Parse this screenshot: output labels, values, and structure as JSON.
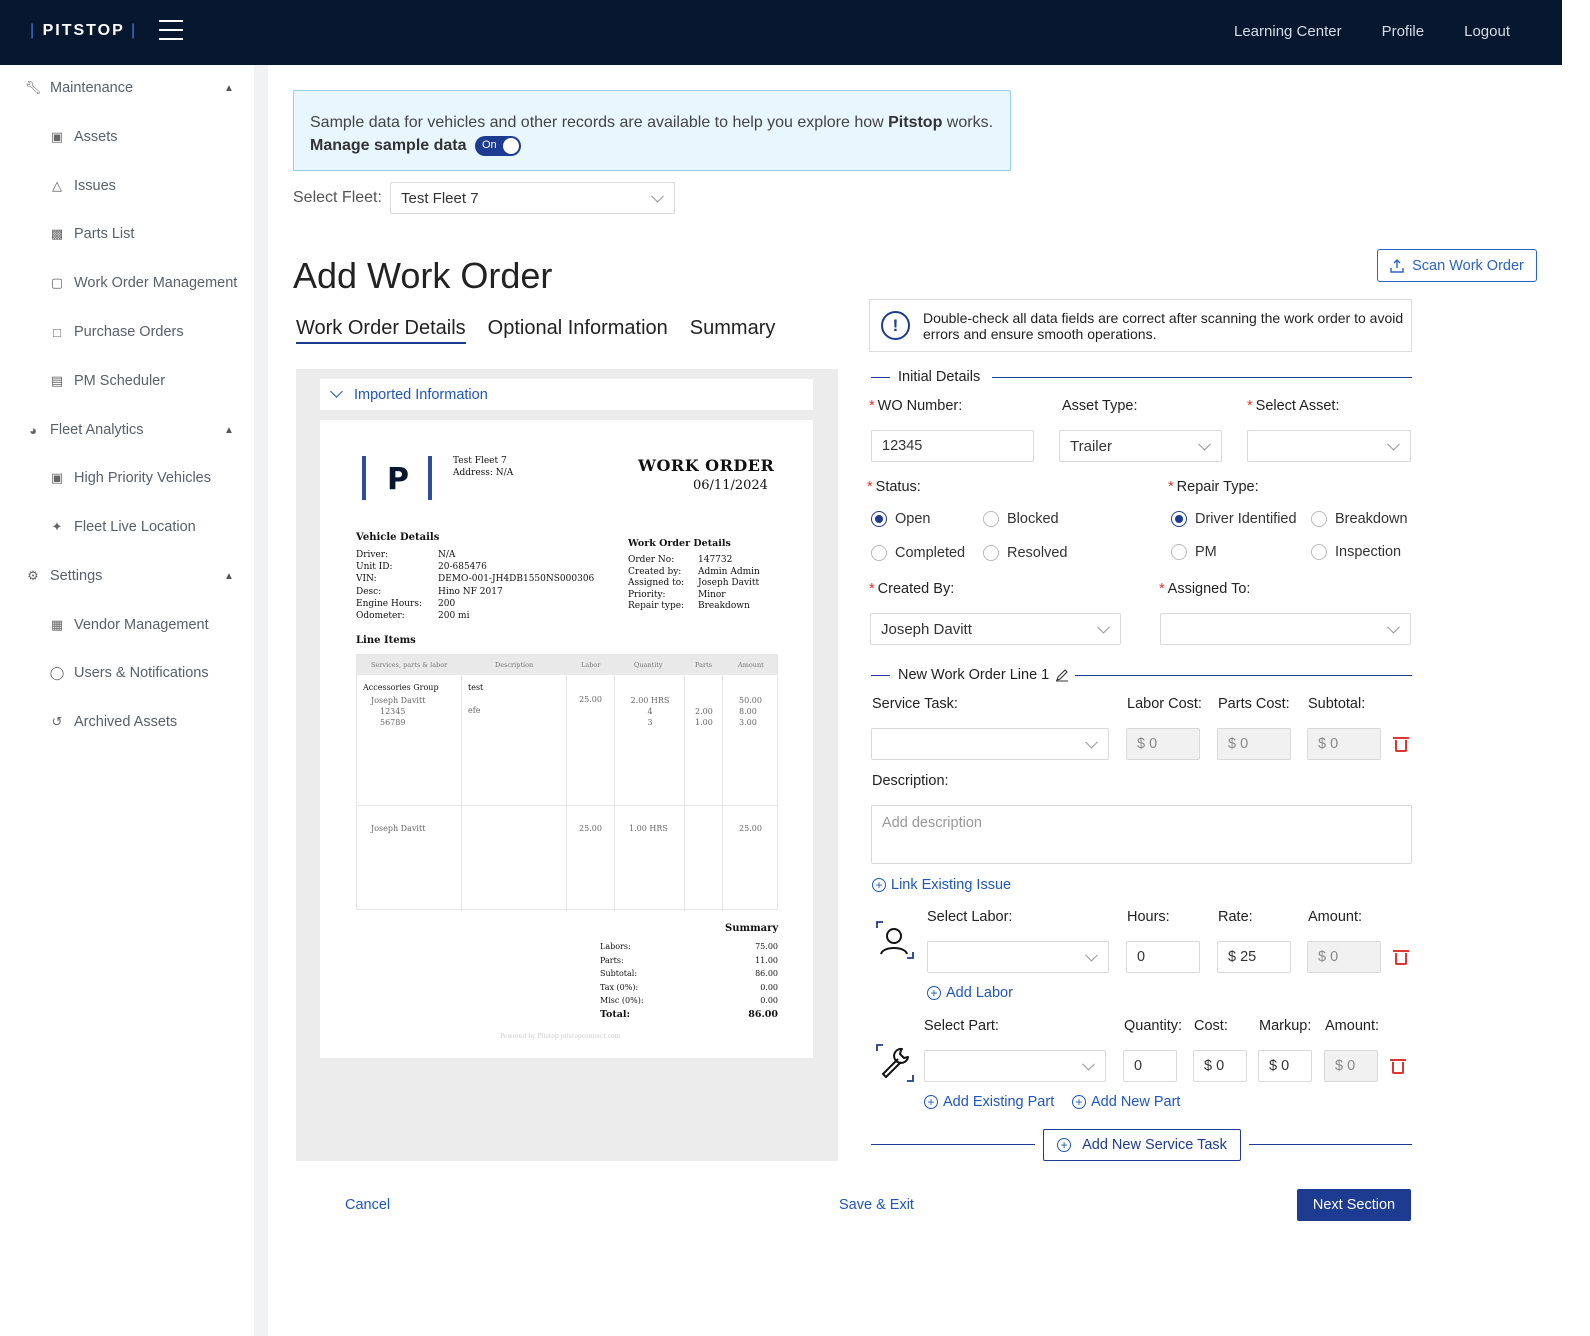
{
  "app": {
    "logo": "PITSTOP"
  },
  "topnav": {
    "learning": "Learning Center",
    "profile": "Profile",
    "logout": "Logout"
  },
  "sidebar": {
    "maintenance": "Maintenance",
    "assets": "Assets",
    "issues": "Issues",
    "parts_list": "Parts List",
    "work_order_mgmt": "Work Order Management",
    "purchase_orders": "Purchase Orders",
    "pm_scheduler": "PM Scheduler",
    "fleet_analytics": "Fleet Analytics",
    "high_priority": "High Priority Vehicles",
    "fleet_live": "Fleet Live Location",
    "settings": "Settings",
    "vendor_mgmt": "Vendor Management",
    "users_notifications": "Users & Notifications",
    "archived_assets": "Archived Assets"
  },
  "banner": {
    "text_before": "Sample data for vehicles and other records are available to help you explore how ",
    "brand": "Pitstop",
    "text_after": " works.",
    "manage": "Manage sample data",
    "toggle": "On"
  },
  "fleet": {
    "label": "Select Fleet:",
    "value": "Test Fleet 7"
  },
  "page": {
    "title": "Add Work Order",
    "tabs": [
      "Work Order Details",
      "Optional Information",
      "Summary"
    ],
    "scan_button": "Scan Work Order",
    "notice": "Double-check all data fields are correct after scanning the work order to avoid errors and ensure smooth operations."
  },
  "imported": {
    "label": "Imported Information",
    "doc": {
      "fleet": "Test Fleet 7",
      "address": "Address: N/A",
      "title": "WORK ORDER",
      "date": "06/11/2024",
      "vehicle_hd": "Vehicle Details",
      "vehicle_labels": [
        "Driver:",
        "Unit ID:",
        "VIN:",
        "Desc:",
        "Engine Hours:",
        "Odometer:"
      ],
      "vehicle_values": [
        "N/A",
        "20-685476",
        "DEMO-001-JH4DB1550NS000306",
        "Hino NF 2017",
        "200",
        "200 mi"
      ],
      "wo_hd": "Work Order Details",
      "wo_labels": [
        "Order No:",
        "Created by:",
        "Assigned to:",
        "Priority:",
        "Repair type:"
      ],
      "wo_values": [
        "147732",
        "Admin Admin",
        "Joseph Davitt",
        "Minor",
        "Breakdown"
      ],
      "line_items_hd": "Line Items",
      "columns": [
        "Services, parts & labor",
        "Description",
        "Labor",
        "Quantity",
        "Parts",
        "Amount"
      ],
      "row1": {
        "group": "Accessories Group",
        "sub": [
          "Joseph Davitt",
          "12345",
          "56789"
        ],
        "desc": [
          "test",
          "efe"
        ],
        "labor": "25.00",
        "qty": [
          "2.00 HRS",
          "4",
          "3"
        ],
        "parts": [
          "2.00",
          "1.00"
        ],
        "amount": [
          "50.00",
          "8.00",
          "3.00"
        ]
      },
      "row2": {
        "name": "Joseph Davitt",
        "labor": "25.00",
        "qty": "1.00 HRS",
        "amount": "25.00"
      },
      "summary_hd": "Summary",
      "summary_labels": [
        "Labors:",
        "Parts:",
        "Subtotal:",
        "Tax (0%):",
        "Misc (0%):",
        "Total:"
      ],
      "summary_values": [
        "75.00",
        "11.00",
        "86.00",
        "0.00",
        "0.00",
        "86.00"
      ],
      "footer": "Powered by Pitstop  pitstopconnect.com"
    }
  },
  "form": {
    "initial_details": "Initial Details",
    "wo_number_label": "WO Number:",
    "wo_number": "12345",
    "asset_type_label": "Asset Type:",
    "asset_type": "Trailer",
    "select_asset_label": "Select Asset:",
    "status_label": "Status:",
    "status_options": [
      "Open",
      "Blocked",
      "Completed",
      "Resolved"
    ],
    "repair_type_label": "Repair Type:",
    "repair_options": [
      "Driver Identified",
      "Breakdown",
      "PM",
      "Inspection"
    ],
    "created_by_label": "Created By:",
    "created_by": "Joseph Davitt",
    "assigned_to_label": "Assigned To:",
    "line_title": "New Work Order Line 1",
    "service_task_label": "Service Task:",
    "labor_cost_label": "Labor Cost:",
    "parts_cost_label": "Parts Cost:",
    "subtotal_label": "Subtotal:",
    "labor_cost": "$ 0",
    "parts_cost": "$ 0",
    "subtotal": "$ 0",
    "description_label": "Description:",
    "description_placeholder": "Add description",
    "link_issue": "Link Existing Issue",
    "select_labor_label": "Select Labor:",
    "hours_label": "Hours:",
    "rate_label": "Rate:",
    "amount_label": "Amount:",
    "hours": "0",
    "rate": "$ 25",
    "labor_amount": "$ 0",
    "add_labor": "Add Labor",
    "select_part_label": "Select Part:",
    "quantity_label": "Quantity:",
    "cost_label": "Cost:",
    "markup_label": "Markup:",
    "part_amount_label": "Amount:",
    "quantity": "0",
    "cost": "$ 0",
    "markup": "$ 0",
    "part_amount": "$ 0",
    "add_existing_part": "Add Existing Part",
    "add_new_part": "Add New Part",
    "add_service_task": "Add New Service Task"
  },
  "footer": {
    "cancel": "Cancel",
    "save_exit": "Save & Exit",
    "next": "Next Section"
  }
}
